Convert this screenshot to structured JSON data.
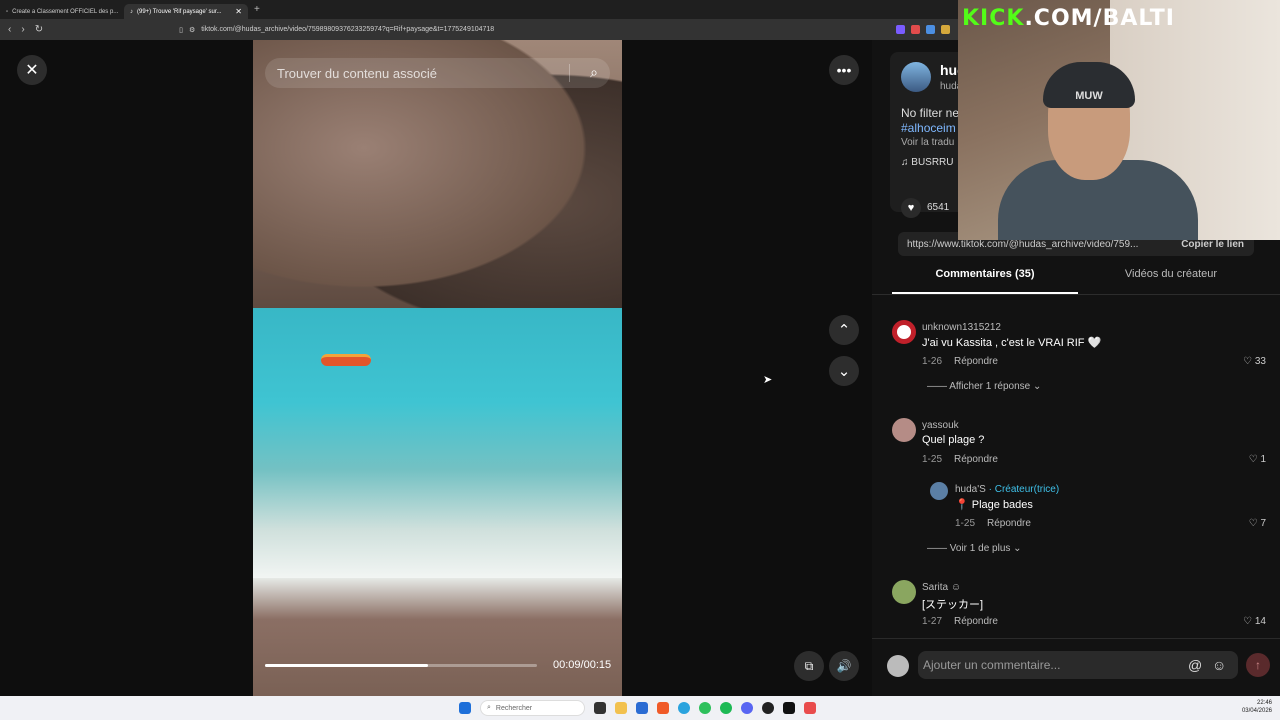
{
  "browser": {
    "tabs": [
      {
        "label": "Create a Classement OFFICIEL des p...",
        "active": false
      },
      {
        "label": "(99+) Trouve 'Rif paysage' sur...",
        "active": true
      }
    ],
    "new_tab": "+",
    "url": "tiktok.com/@hudas_archive/video/7598980937623325974?q=Rif+paysage&t=1775249104718"
  },
  "video": {
    "search_placeholder": "Trouver du contenu associé",
    "time": "00:09/00:15",
    "progress": 0.6
  },
  "panel": {
    "username": "hud",
    "handle": "huda",
    "description": "No filter ne",
    "hashtag": "#alhoceim",
    "translate": "Voir la tradu",
    "music": "♫  BUSRRU",
    "likes": "6541",
    "link": "https://www.tiktok.com/@hudas_archive/video/759...",
    "copy_link": "Copier le lien",
    "tab_comments": "Commentaires (35)",
    "tab_videos": "Vidéos du créateur"
  },
  "comments": [
    {
      "name": "unknown1315212",
      "text": "J'ai vu Kassita , c'est le VRAI RIF 🤍",
      "date": "1-26",
      "reply": "Répondre",
      "likes": "33",
      "more": "Afficher 1 réponse ⌄",
      "avatar_color": "#c0202a"
    },
    {
      "name": "yassouk",
      "text": "Quel plage ?",
      "date": "1-25",
      "reply": "Répondre",
      "likes": "1",
      "avatar_color": "#b58c86"
    },
    {
      "name": "huda'S",
      "creator": "· Créateur(trice)",
      "text": "📍 Plage bades",
      "date": "1-25",
      "reply": "Répondre",
      "likes": "7",
      "more": "Voir 1 de plus ⌄",
      "avatar_color": "#5b7fa5"
    },
    {
      "name": "Sarita ☺",
      "text": "[ステッカー]",
      "date": "1-27",
      "reply": "Répondre",
      "likes": "14",
      "avatar_color": "#8aa660"
    }
  ],
  "comment_bar": {
    "placeholder": "Ajouter un commentaire..."
  },
  "overlay": {
    "kick_prefix": "KICK",
    "kick_suffix": ".COM/BALTI",
    "beanie_text": "MUW"
  },
  "taskbar": {
    "search": "Rechercher",
    "time": "22:46",
    "date": "03/04/2026"
  }
}
